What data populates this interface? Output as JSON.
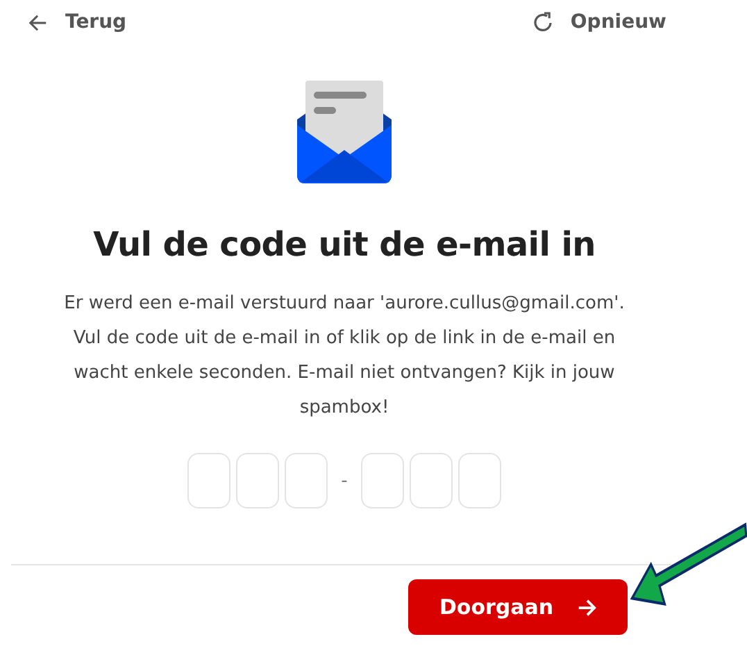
{
  "nav": {
    "back": "Terug",
    "retry": "Opnieuw"
  },
  "heading": "Vul de code uit de e-mail in",
  "message": "Er werd een e-mail verstuurd naar 'aurore.cullus@gmail.com'. Vul de code uit de e-mail in of klik op de link in de e-mail en wacht enkele seconden. E-mail niet ontvangen? Kijk in jouw spambox!",
  "code_fields": [
    {
      "kind": "digit"
    },
    {
      "kind": "digit"
    },
    {
      "kind": "digit"
    },
    {
      "kind": "separator",
      "text": "-"
    },
    {
      "kind": "digit"
    },
    {
      "kind": "digit"
    },
    {
      "kind": "digit"
    }
  ],
  "continue_button": "Doorgaan"
}
